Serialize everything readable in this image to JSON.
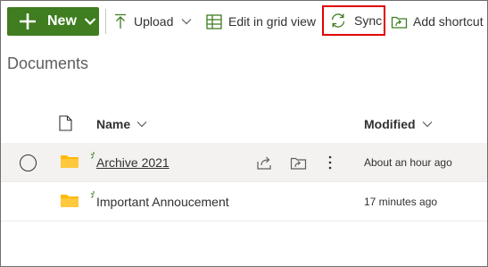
{
  "toolbar": {
    "new_label": "New",
    "upload_label": "Upload",
    "grid_label": "Edit in grid view",
    "sync_label": "Sync",
    "shortcut_label": "Add shortcut",
    "sync_highlight_color": "#e00000",
    "new_button_color": "#3f7d20"
  },
  "library": {
    "title": "Documents"
  },
  "columns": {
    "name": "Name",
    "modified": "Modified"
  },
  "rows": [
    {
      "name": "Archive 2021",
      "modified": "About an hour ago",
      "type": "folder-icon"
    },
    {
      "name": "Important Annoucement",
      "modified": "17 minutes ago",
      "type": "folder-icon"
    }
  ]
}
